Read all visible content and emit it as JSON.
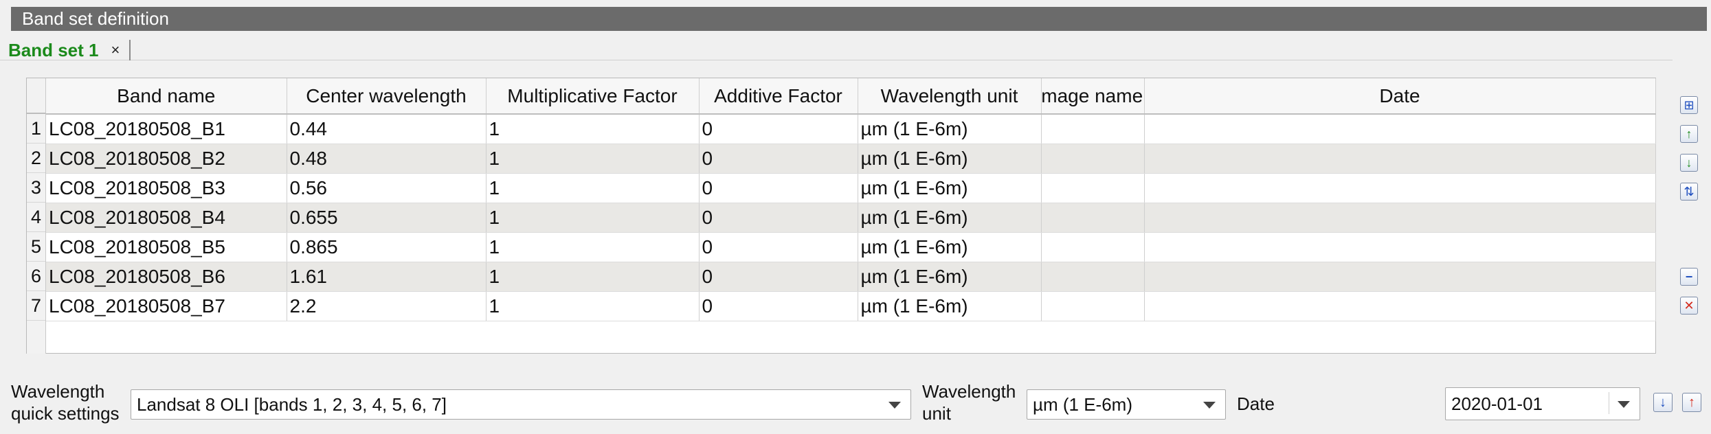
{
  "panel": {
    "title": "Band set definition"
  },
  "tabs": [
    {
      "label": "Band set 1",
      "close": "×"
    }
  ],
  "table": {
    "columns": [
      "Band name",
      "Center wavelength",
      "Multiplicative Factor",
      "Additive Factor",
      "Wavelength unit",
      "Image name",
      "Date"
    ],
    "row_numbers": [
      "1",
      "2",
      "3",
      "4",
      "5",
      "6",
      "7"
    ],
    "rows": [
      [
        "LC08_20180508_B1",
        "0.44",
        "1",
        "0",
        "µm (1 E-6m)",
        "",
        ""
      ],
      [
        "LC08_20180508_B2",
        "0.48",
        "1",
        "0",
        "µm (1 E-6m)",
        "",
        ""
      ],
      [
        "LC08_20180508_B3",
        "0.56",
        "1",
        "0",
        "µm (1 E-6m)",
        "",
        ""
      ],
      [
        "LC08_20180508_B4",
        "0.655",
        "1",
        "0",
        "µm (1 E-6m)",
        "",
        ""
      ],
      [
        "LC08_20180508_B5",
        "0.865",
        "1",
        "0",
        "µm (1 E-6m)",
        "",
        ""
      ],
      [
        "LC08_20180508_B6",
        "1.61",
        "1",
        "0",
        "µm (1 E-6m)",
        "",
        ""
      ],
      [
        "LC08_20180508_B7",
        "2.2",
        "1",
        "0",
        "µm (1 E-6m)",
        "",
        ""
      ]
    ]
  },
  "side_tools": [
    {
      "name": "add-bands-icon",
      "glyph": "⊞"
    },
    {
      "name": "move-up-icon",
      "glyph": "↑"
    },
    {
      "name": "move-down-icon",
      "glyph": "↓"
    },
    {
      "name": "sort-by-name-icon",
      "glyph": "⇅"
    },
    {
      "name": "remove-band-icon",
      "glyph": "−"
    },
    {
      "name": "clear-band-set-icon",
      "glyph": "✕"
    }
  ],
  "bottom": {
    "wavelength_quick_settings_label_line1": "Wavelength",
    "wavelength_quick_settings_label_line2": "quick settings",
    "wavelength_quick_settings_value": "Landsat 8 OLI [bands 1, 2, 3, 4, 5, 6, 7]",
    "wavelength_unit_label_line1": "Wavelength",
    "wavelength_unit_label_line2": "unit",
    "wavelength_unit_value": "µm (1 E-6m)",
    "date_label": "Date",
    "date_value": "2020-01-01",
    "import_glyph": "↓",
    "export_glyph": "↑"
  },
  "colors": {
    "title_bar": "#6b6b6b",
    "tab_label": "#1b8a1b",
    "alt_row": "#e9e8e5",
    "import_arrow": "#1f4fbf",
    "export_arrow": "#d42a1c",
    "tool_green": "#1d8a1d"
  }
}
